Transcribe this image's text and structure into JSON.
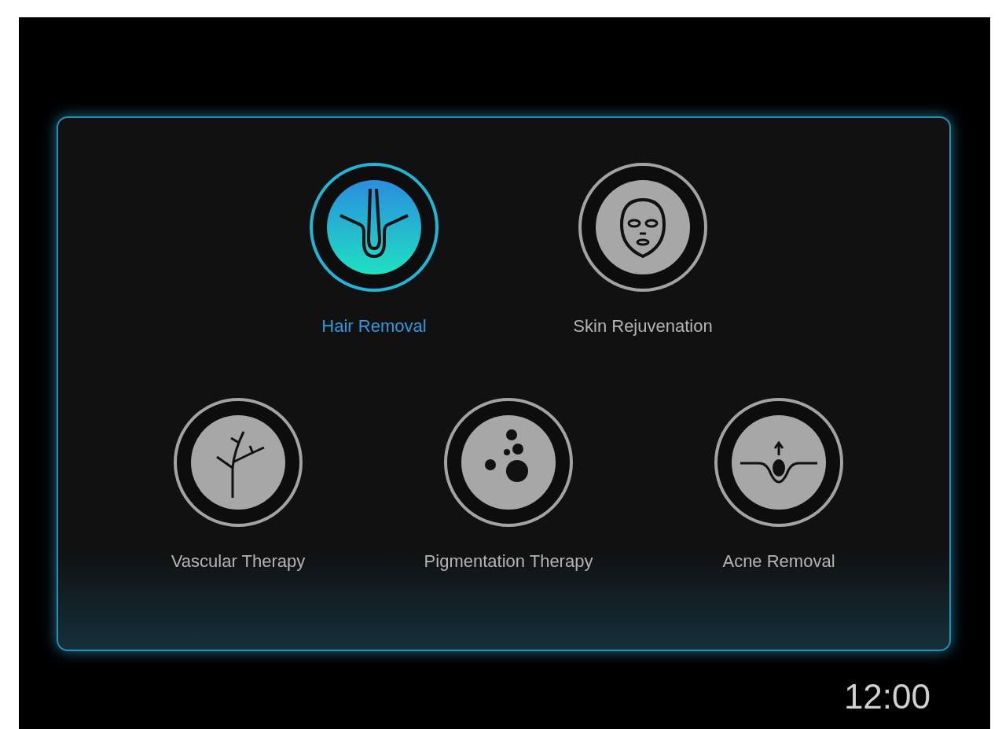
{
  "treatment_rows": [
    [
      {
        "kind": "hair",
        "label": "Hair Removal",
        "selected": true
      },
      {
        "kind": "face",
        "label": "Skin Rejuvenation",
        "selected": false
      }
    ],
    [
      {
        "kind": "vessel",
        "label": "Vascular Therapy",
        "selected": false
      },
      {
        "kind": "pigment",
        "label": "Pigmentation Therapy",
        "selected": false
      },
      {
        "kind": "acne",
        "label": "Acne Removal",
        "selected": false
      }
    ]
  ],
  "clock": "12:00"
}
